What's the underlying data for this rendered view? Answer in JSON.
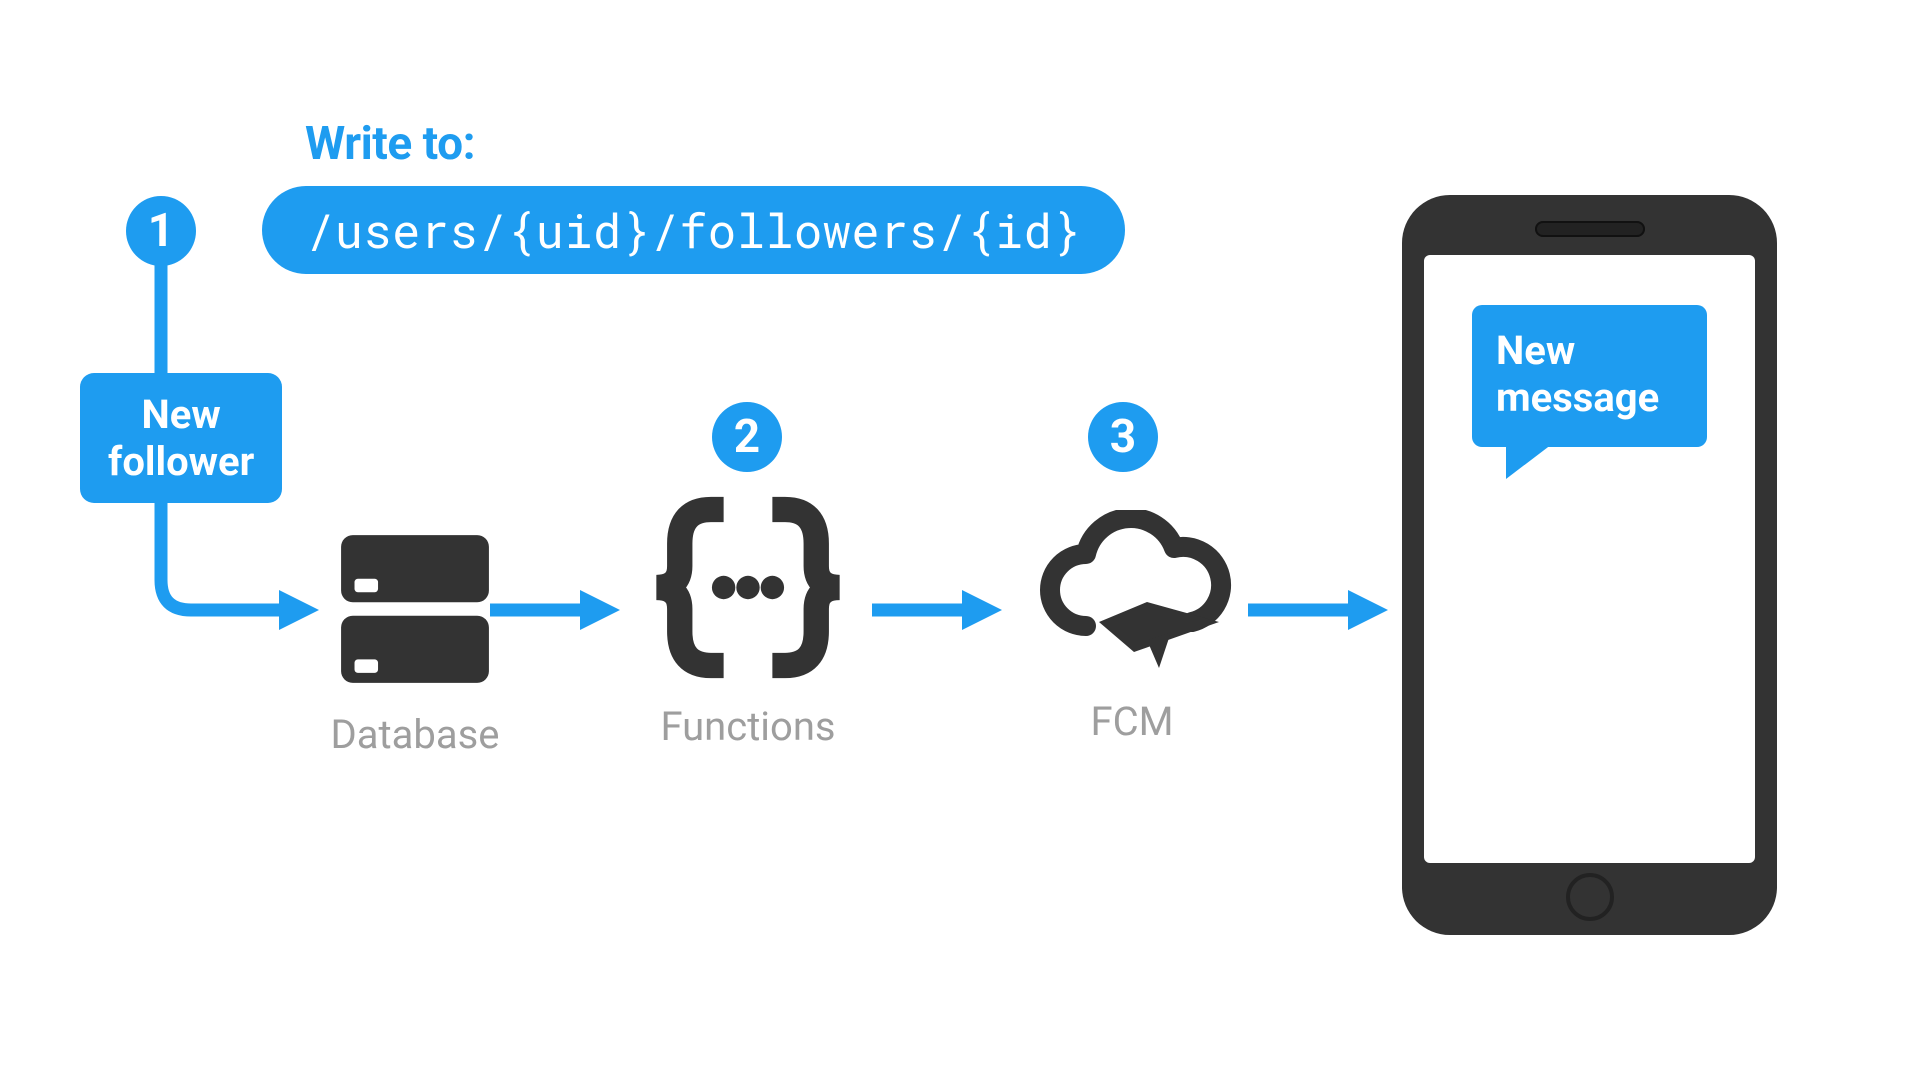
{
  "header": {
    "label": "Write to:",
    "path": "/users/{uid}/followers/{id}"
  },
  "steps": [
    {
      "n": "1"
    },
    {
      "n": "2"
    },
    {
      "n": "3"
    }
  ],
  "trigger": {
    "line1": "New",
    "line2": "follower"
  },
  "nodes": {
    "database": "Database",
    "functions": "Functions",
    "fcm": "FCM"
  },
  "notification": {
    "line1": "New",
    "line2": "message"
  },
  "colors": {
    "accent": "#1e9cf0",
    "icon": "#333333",
    "label": "#9e9e9e"
  }
}
